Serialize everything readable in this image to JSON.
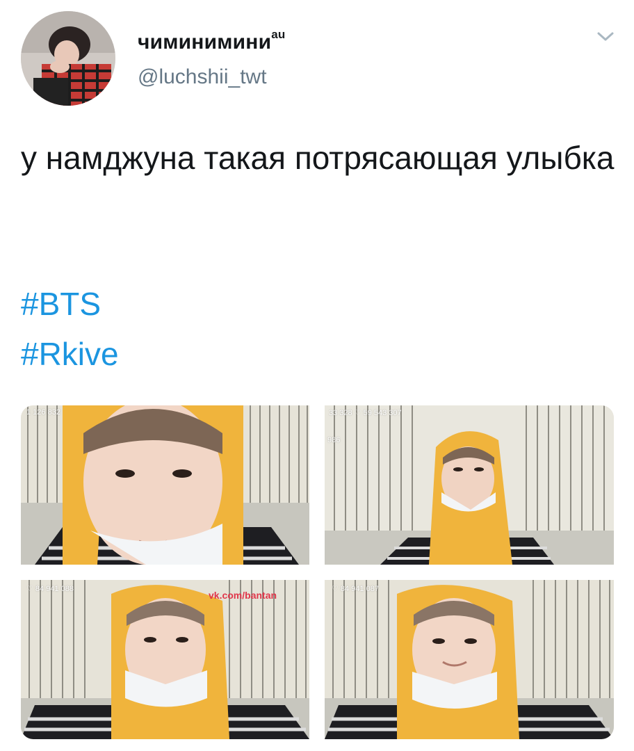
{
  "tweet": {
    "display_name": "чиминимини",
    "display_name_suffix": "au",
    "handle": "@luchshii_twt",
    "text": "у намджуна такая потрясающая улыбка",
    "hashtags": [
      "#BTS",
      "#Rkive"
    ]
  },
  "colors": {
    "hashtag": "#1b95e0",
    "handle": "#657786",
    "text": "#14171a",
    "hood": "#f0b43c",
    "watermark": "#e0364a"
  },
  "icons": {
    "menu": "chevron-down-icon",
    "like_counter": "heart-icon"
  },
  "media": {
    "photos": [
      {
        "overlay": "1 126 832"
      },
      {
        "overlay": "33 328   ♡ 59 543 307",
        "overlay2": "986"
      },
      {
        "overlay": "♡ 84 941 088",
        "watermark": "vk.com/bantan"
      },
      {
        "overlay": "♡ 84 941 087"
      }
    ]
  }
}
